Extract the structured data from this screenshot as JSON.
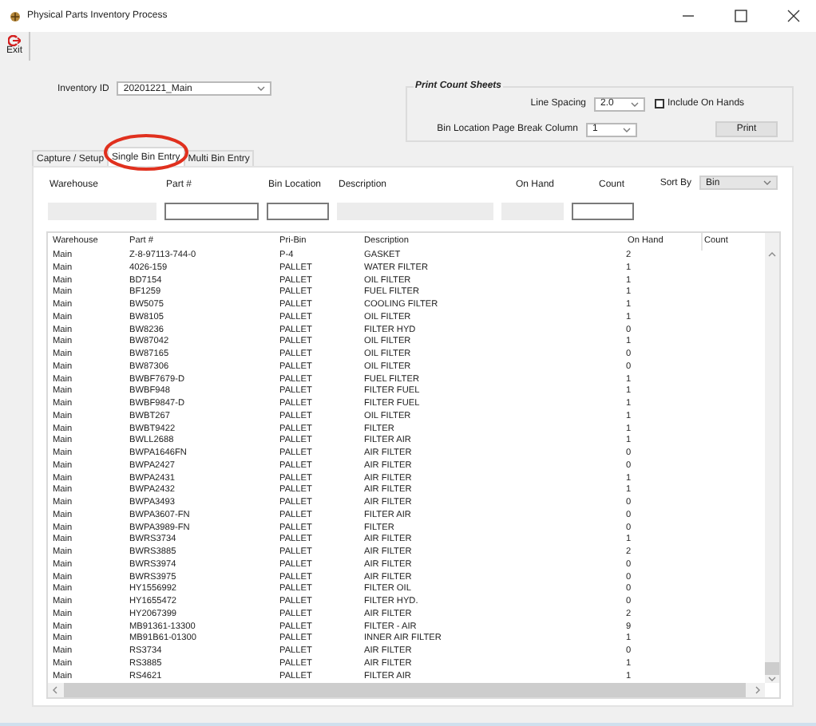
{
  "window": {
    "title": "Physical Parts Inventory Process"
  },
  "toolbar": [
    {
      "label": "Exit"
    }
  ],
  "inventory_id": {
    "label": "Inventory ID",
    "value": "20201221_Main"
  },
  "print_count_sheets": {
    "title": "Print Count Sheets",
    "line_spacing": {
      "label": "Line Spacing",
      "value": "2.0"
    },
    "include_on_hands": {
      "label": "Include On Hands",
      "checked": false
    },
    "page_break": {
      "label": "Bin Location Page Break Column",
      "value": "1"
    },
    "print_button": "Print"
  },
  "tabs": [
    {
      "label": "Capture / Setup",
      "selected": false,
      "circled": false
    },
    {
      "label": "Single Bin Entry",
      "selected": true,
      "circled": true
    },
    {
      "label": "Multi Bin Entry",
      "selected": false,
      "circled": false
    }
  ],
  "filters": {
    "fields": [
      {
        "label": "Warehouse",
        "disabled": true
      },
      {
        "label": "Part #",
        "disabled": false
      },
      {
        "label": "Bin Location",
        "disabled": false
      },
      {
        "label": "Description",
        "disabled": true
      },
      {
        "label": "On Hand",
        "disabled": true
      },
      {
        "label": "Count",
        "disabled": false
      }
    ],
    "sort_by": {
      "label": "Sort By",
      "value": "Bin"
    }
  },
  "table": {
    "columns": [
      "Warehouse",
      "Part #",
      "Pri-Bin",
      "Description",
      "On Hand",
      "Count"
    ],
    "rows": [
      [
        "Main",
        "Z-8-97113-744-0",
        "P-4",
        "GASKET",
        "2"
      ],
      [
        "Main",
        "4026-159",
        "PALLET",
        "WATER FILTER",
        "1"
      ],
      [
        "Main",
        "BD7154",
        "PALLET",
        "OIL FILTER",
        "1"
      ],
      [
        "Main",
        "BF1259",
        "PALLET",
        "FUEL FILTER",
        "1"
      ],
      [
        "Main",
        "BW5075",
        "PALLET",
        "COOLING FILTER",
        "1"
      ],
      [
        "Main",
        "BW8105",
        "PALLET",
        "OIL FILTER",
        "1"
      ],
      [
        "Main",
        "BW8236",
        "PALLET",
        "FILTER HYD",
        "0"
      ],
      [
        "Main",
        "BW87042",
        "PALLET",
        "OIL FILTER",
        "1"
      ],
      [
        "Main",
        "BW87165",
        "PALLET",
        "OIL FILTER",
        "0"
      ],
      [
        "Main",
        "BW87306",
        "PALLET",
        "OIL FILTER",
        "0"
      ],
      [
        "Main",
        "BWBF7679-D",
        "PALLET",
        "FUEL FILTER",
        "1"
      ],
      [
        "Main",
        "BWBF948",
        "PALLET",
        "FILTER FUEL",
        "1"
      ],
      [
        "Main",
        "BWBF9847-D",
        "PALLET",
        "FILTER FUEL",
        "1"
      ],
      [
        "Main",
        "BWBT267",
        "PALLET",
        "OIL FILTER",
        "1"
      ],
      [
        "Main",
        "BWBT9422",
        "PALLET",
        "FILTER",
        "1"
      ],
      [
        "Main",
        "BWLL2688",
        "PALLET",
        "FILTER AIR",
        "1"
      ],
      [
        "Main",
        "BWPA1646FN",
        "PALLET",
        "AIR FILTER",
        "0"
      ],
      [
        "Main",
        "BWPA2427",
        "PALLET",
        "AIR FILTER",
        "0"
      ],
      [
        "Main",
        "BWPA2431",
        "PALLET",
        "AIR FILTER",
        "1"
      ],
      [
        "Main",
        "BWPA2432",
        "PALLET",
        "AIR FILTER",
        "1"
      ],
      [
        "Main",
        "BWPA3493",
        "PALLET",
        "AIR FILTER",
        "0"
      ],
      [
        "Main",
        "BWPA3607-FN",
        "PALLET",
        "FILTER AIR",
        "0"
      ],
      [
        "Main",
        "BWPA3989-FN",
        "PALLET",
        "FILTER",
        "0"
      ],
      [
        "Main",
        "BWRS3734",
        "PALLET",
        "AIR FILTER",
        "1"
      ],
      [
        "Main",
        "BWRS3885",
        "PALLET",
        "AIR FILTER",
        "2"
      ],
      [
        "Main",
        "BWRS3974",
        "PALLET",
        "AIR FILTER",
        "0"
      ],
      [
        "Main",
        "BWRS3975",
        "PALLET",
        "AIR FILTER",
        "0"
      ],
      [
        "Main",
        "HY1556992",
        "PALLET",
        "FILTER OIL",
        "0"
      ],
      [
        "Main",
        "HY1655472",
        "PALLET",
        "FILTER HYD.",
        "0"
      ],
      [
        "Main",
        "HY2067399",
        "PALLET",
        "AIR FILTER",
        "2"
      ],
      [
        "Main",
        "MB91361-13300",
        "PALLET",
        "FILTER - AIR",
        "9"
      ],
      [
        "Main",
        "MB91B61-01300",
        "PALLET",
        "INNER AIR FILTER",
        "1"
      ],
      [
        "Main",
        "RS3734",
        "PALLET",
        "AIR FILTER",
        "0"
      ],
      [
        "Main",
        "RS3885",
        "PALLET",
        "AIR FILTER",
        "1"
      ],
      [
        "Main",
        "RS4621",
        "PALLET",
        "FILTER AIR",
        "1"
      ]
    ]
  }
}
